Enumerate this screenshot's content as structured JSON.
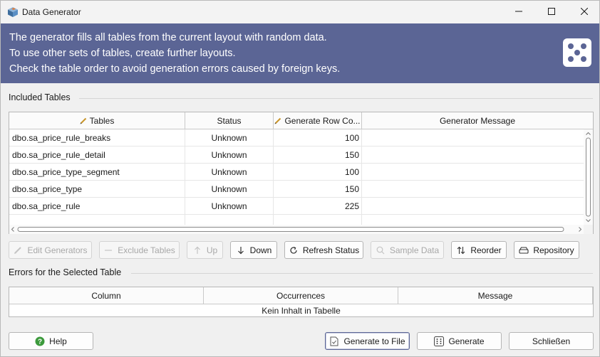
{
  "window": {
    "title": "Data Generator",
    "icons": {
      "app": "cube-icon",
      "minimize": "minimize-icon",
      "maximize": "maximize-icon",
      "close": "close-icon"
    }
  },
  "banner": {
    "lines": [
      "The generator fills all tables from the current layout with random data.",
      "To use other sets of tables, create further layouts.",
      "Check the table order to avoid generation errors caused by foreign keys."
    ],
    "icon": "dice-icon",
    "background": "#5b6595"
  },
  "included": {
    "title": "Included Tables",
    "columns": [
      "Tables",
      "Status",
      "Generate Row Co...",
      "Generator Message"
    ],
    "rows": [
      {
        "table": "dbo.sa_price_rule_breaks",
        "status": "Unknown",
        "count": "100",
        "message": ""
      },
      {
        "table": "dbo.sa_price_rule_detail",
        "status": "Unknown",
        "count": "150",
        "message": ""
      },
      {
        "table": "dbo.sa_price_type_segment",
        "status": "Unknown",
        "count": "100",
        "message": ""
      },
      {
        "table": "dbo.sa_price_type",
        "status": "Unknown",
        "count": "150",
        "message": ""
      },
      {
        "table": "dbo.sa_price_rule",
        "status": "Unknown",
        "count": "225",
        "message": ""
      }
    ]
  },
  "toolbar": {
    "edit_generators": "Edit Generators",
    "exclude_tables": "Exclude Tables",
    "up": "Up",
    "down": "Down",
    "refresh_status": "Refresh Status",
    "sample_data": "Sample Data",
    "reorder": "Reorder",
    "repository": "Repository"
  },
  "errors": {
    "title": "Errors for the Selected Table",
    "columns": [
      "Column",
      "Occurrences",
      "Message"
    ],
    "empty_text": "Kein Inhalt in Tabelle"
  },
  "footer": {
    "help": "Help",
    "generate_to_file": "Generate to File",
    "generate": "Generate",
    "close": "Schließen"
  }
}
